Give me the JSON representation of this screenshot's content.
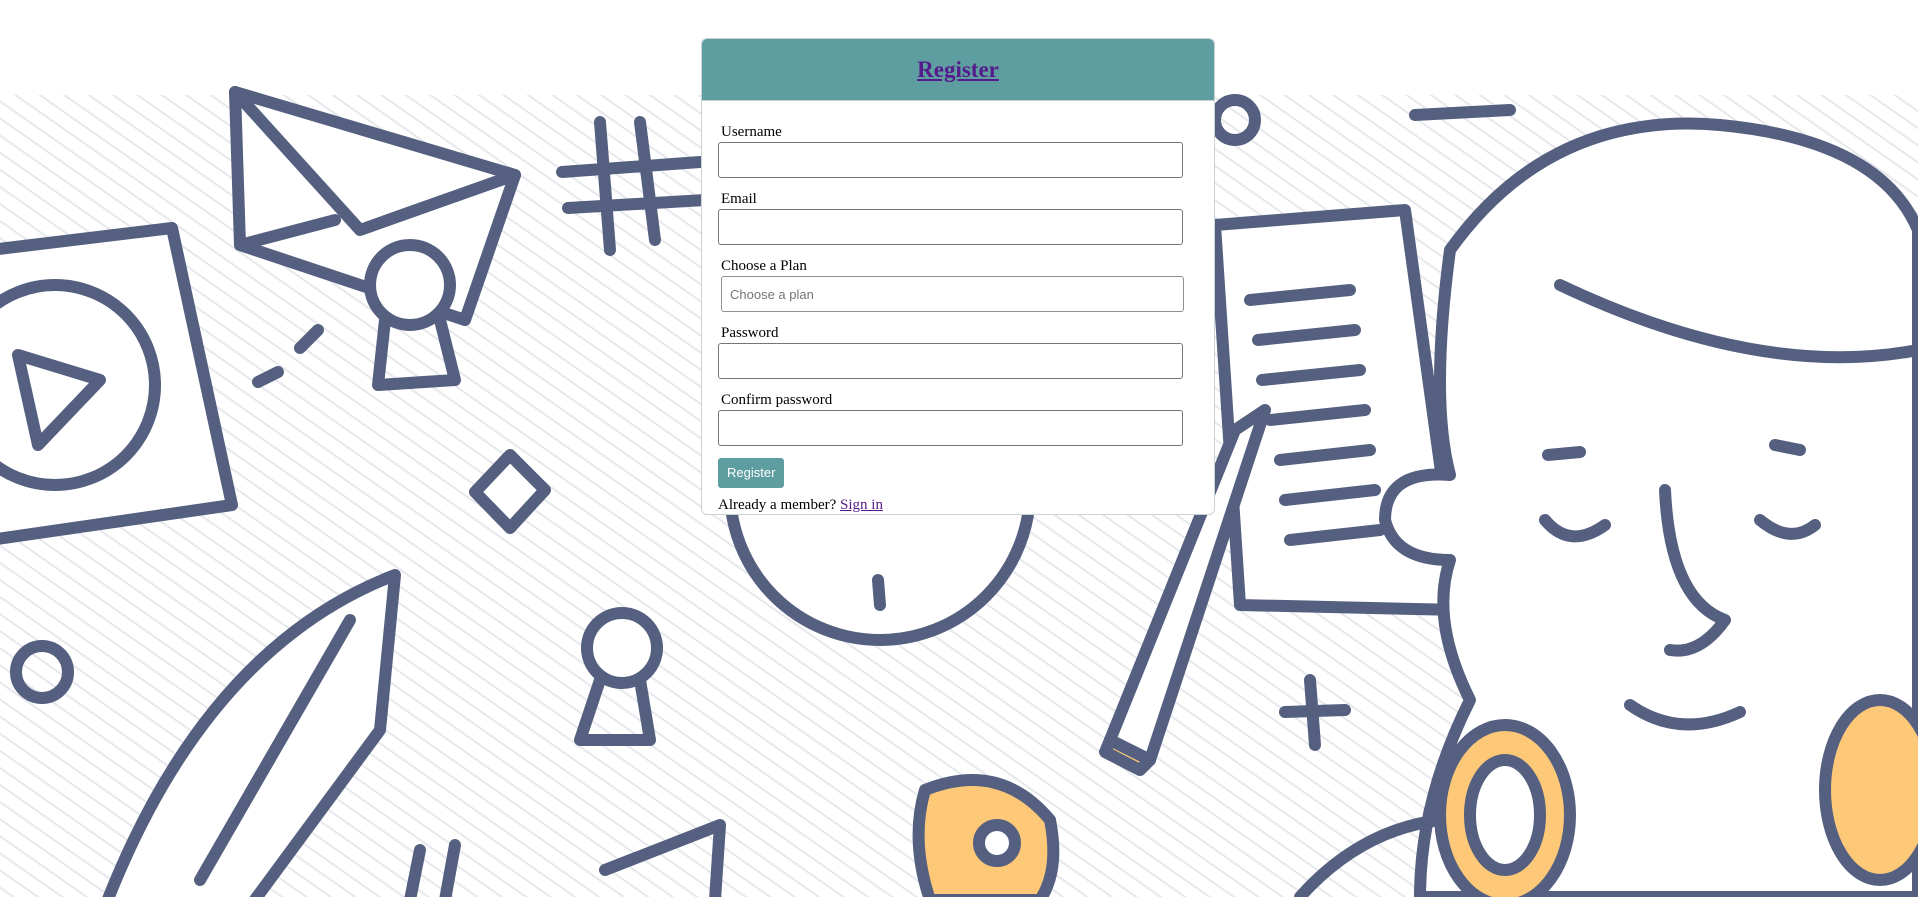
{
  "form": {
    "title": "Register",
    "fields": [
      {
        "label": "Username",
        "value": "",
        "placeholder": ""
      },
      {
        "label": "Email",
        "value": "",
        "placeholder": ""
      },
      {
        "label": "Choose a Plan",
        "value": "",
        "placeholder": "Choose a plan"
      },
      {
        "label": "Password",
        "value": "",
        "placeholder": ""
      },
      {
        "label": "Confirm password",
        "value": "",
        "placeholder": ""
      }
    ],
    "submit_label": "Register",
    "member_text": "Already a member?",
    "signin_label": "Sign in"
  },
  "colors": {
    "accent": "#5f9ea0",
    "link": "#551a8b",
    "doodle_stroke": "#556080",
    "doodle_fill": "#fdc878",
    "doodle_shadow": "#dcdde4"
  },
  "background": {
    "icons": [
      "play-icon",
      "envelope-icon",
      "hashtag-icon",
      "certificate-icon",
      "diamond-icon",
      "magnifier-icon",
      "notepad-icon",
      "pencil-icon",
      "person-icon",
      "plus-icon",
      "location-pin-icon",
      "leaf-icon"
    ]
  }
}
